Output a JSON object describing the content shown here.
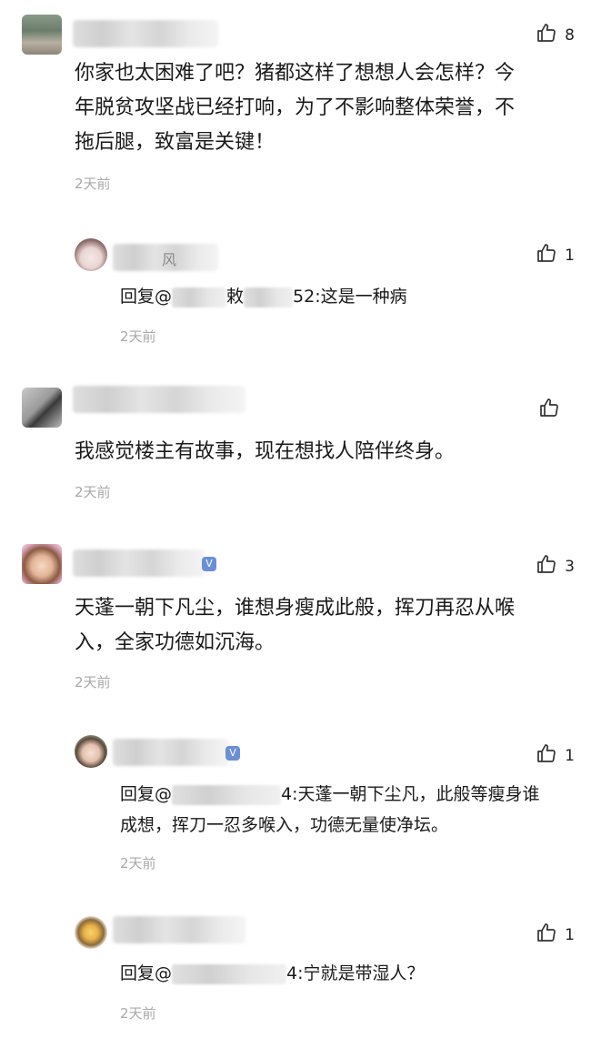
{
  "comments": [
    {
      "likes": "8",
      "text_lines": [
        "你家也太困难了吧？猪都这样了想想人会怎样？今",
        "年脱贫攻坚战已经打响，为了不影响整体荣誉，不",
        "拖后腿，致富是关键！"
      ],
      "time": "2天前"
    },
    {
      "likes": "",
      "text_lines": [
        "我感觉楼主有故事，现在想找人陪伴终身。"
      ],
      "time": "2天前"
    },
    {
      "likes": "3",
      "text_lines": [
        "天蓬一朝下凡尘，谁想身瘦成此般，挥刀再忍从喉",
        "入，全家功德如沉海。"
      ],
      "time": "2天前"
    }
  ],
  "replies": [
    {
      "likes": "1",
      "name_fragment": "风",
      "prefix": "回复@",
      "mid_fragment": "敕",
      "suffix": "52:这是一种病",
      "time": "2天前"
    },
    {
      "likes": "1",
      "prefix": "回复@",
      "suffix_line1": "4:天蓬一朝下尘凡，此般等瘦身谁",
      "line2": "成想，挥刀一忍多喉入，功德无量使净坛。",
      "time": "2天前"
    },
    {
      "likes": "1",
      "prefix": "回复@",
      "suffix": "4:宁就是带湿人？",
      "time": "2天前"
    }
  ],
  "icons": {
    "like": "thumbs-up-icon",
    "vip_badge": "vip-badge-icon"
  },
  "colors": {
    "time": "#a8a8a8",
    "text": "#1a1a1a",
    "badge": "#6b8fd6"
  }
}
